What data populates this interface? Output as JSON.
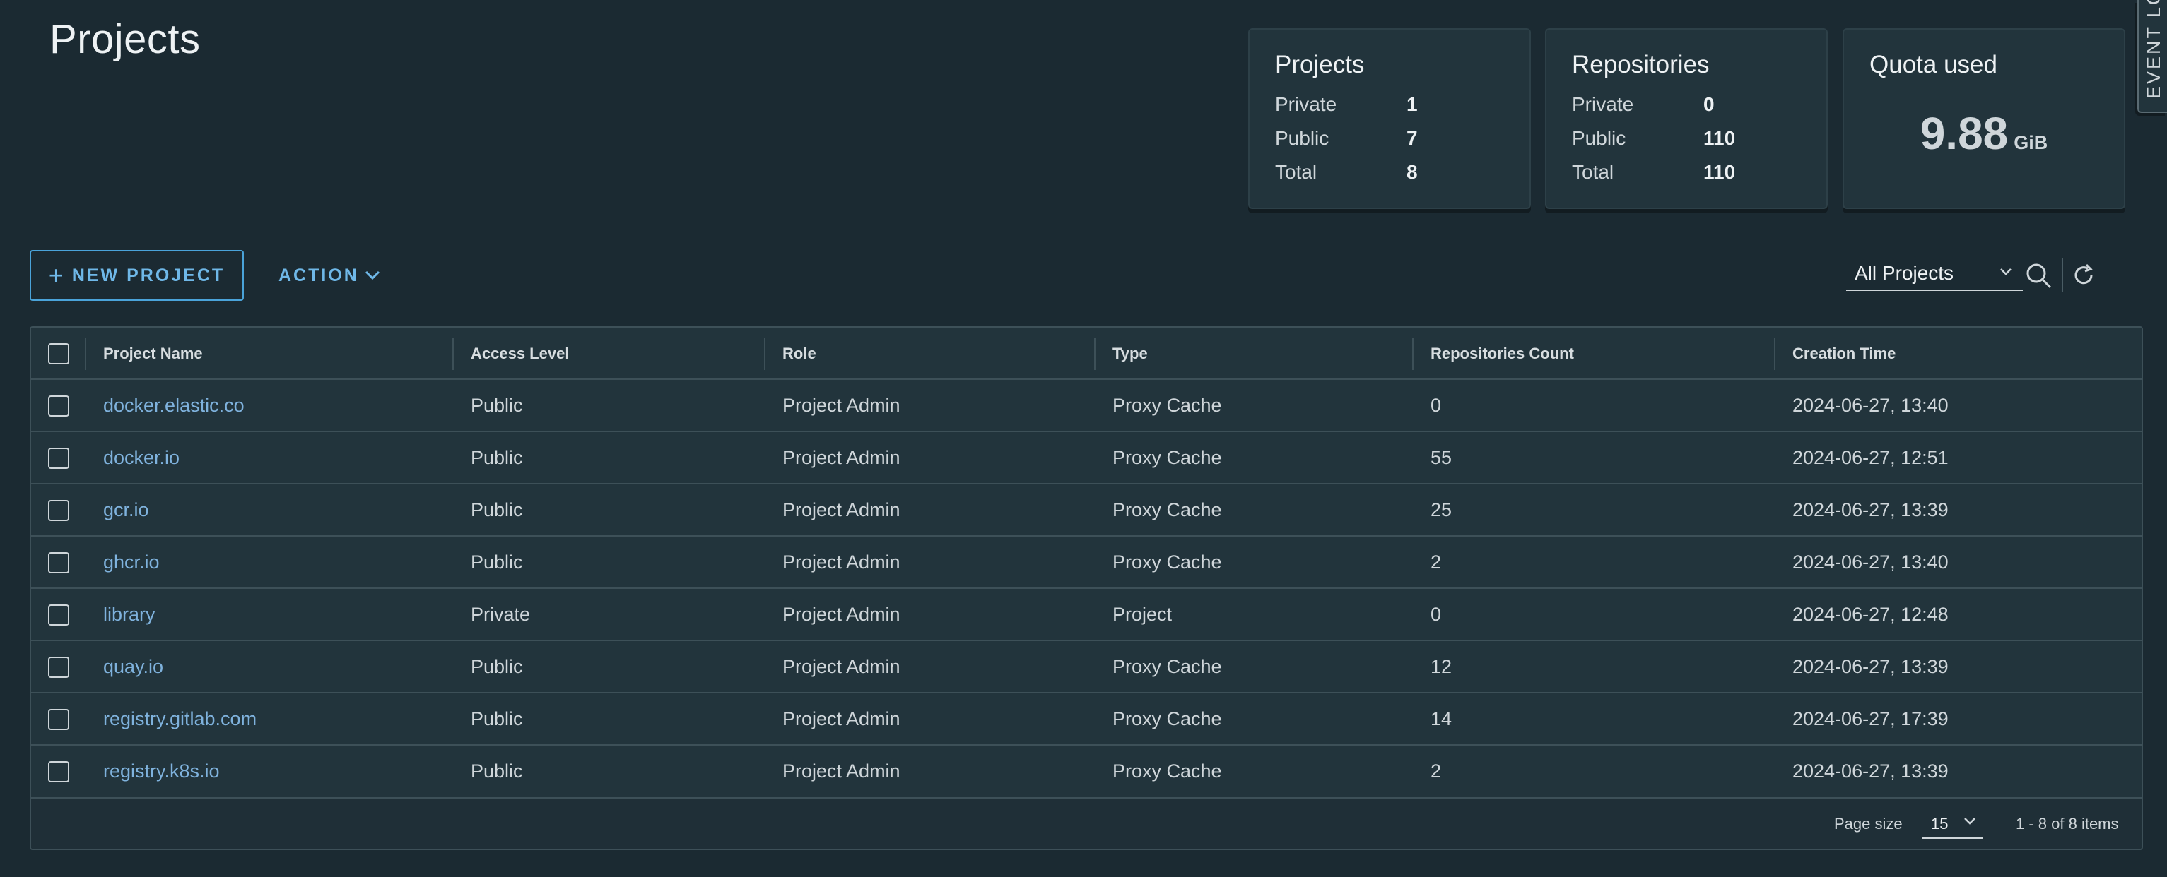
{
  "page": {
    "title": "Projects"
  },
  "summary": {
    "projects": {
      "title": "Projects",
      "rows": [
        {
          "label": "Private",
          "value": "1"
        },
        {
          "label": "Public",
          "value": "7"
        },
        {
          "label": "Total",
          "value": "8"
        }
      ]
    },
    "repositories": {
      "title": "Repositories",
      "rows": [
        {
          "label": "Private",
          "value": "0"
        },
        {
          "label": "Public",
          "value": "110"
        },
        {
          "label": "Total",
          "value": "110"
        }
      ]
    },
    "quota": {
      "title": "Quota used",
      "value": "9.88",
      "unit": "GiB"
    }
  },
  "event_tab": {
    "label": "EVENT LOG"
  },
  "toolbar": {
    "new_project_label": "NEW PROJECT",
    "action_label": "ACTION",
    "filter_value": "All Projects"
  },
  "table": {
    "columns": [
      "Project Name",
      "Access Level",
      "Role",
      "Type",
      "Repositories Count",
      "Creation Time"
    ],
    "rows": [
      {
        "name": "docker.elastic.co",
        "access": "Public",
        "role": "Project Admin",
        "type": "Proxy Cache",
        "repos": "0",
        "created": "2024-06-27, 13:40"
      },
      {
        "name": "docker.io",
        "access": "Public",
        "role": "Project Admin",
        "type": "Proxy Cache",
        "repos": "55",
        "created": "2024-06-27, 12:51"
      },
      {
        "name": "gcr.io",
        "access": "Public",
        "role": "Project Admin",
        "type": "Proxy Cache",
        "repos": "25",
        "created": "2024-06-27, 13:39"
      },
      {
        "name": "ghcr.io",
        "access": "Public",
        "role": "Project Admin",
        "type": "Proxy Cache",
        "repos": "2",
        "created": "2024-06-27, 13:40"
      },
      {
        "name": "library",
        "access": "Private",
        "role": "Project Admin",
        "type": "Project",
        "repos": "0",
        "created": "2024-06-27, 12:48"
      },
      {
        "name": "quay.io",
        "access": "Public",
        "role": "Project Admin",
        "type": "Proxy Cache",
        "repos": "12",
        "created": "2024-06-27, 13:39"
      },
      {
        "name": "registry.gitlab.com",
        "access": "Public",
        "role": "Project Admin",
        "type": "Proxy Cache",
        "repos": "14",
        "created": "2024-06-27, 17:39"
      },
      {
        "name": "registry.k8s.io",
        "access": "Public",
        "role": "Project Admin",
        "type": "Proxy Cache",
        "repos": "2",
        "created": "2024-06-27, 13:39"
      }
    ]
  },
  "footer": {
    "page_size_label": "Page size",
    "page_size_value": "15",
    "page_info": "1 - 8 of 8 items"
  },
  "colors": {
    "background": "#1b2a32",
    "card": "#22343c",
    "accent": "#6fb8e8",
    "link": "#7fb2dd"
  },
  "icons": {
    "new_project": "plus-icon",
    "action": "chevron-down-icon",
    "search": "search-icon",
    "refresh": "refresh-icon"
  }
}
